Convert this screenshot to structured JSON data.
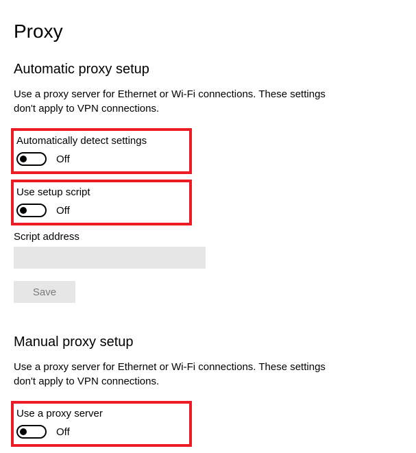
{
  "page": {
    "title": "Proxy"
  },
  "automatic": {
    "heading": "Automatic proxy setup",
    "description": "Use a proxy server for Ethernet or Wi-Fi connections. These settings don't apply to VPN connections.",
    "autodetect": {
      "label": "Automatically detect settings",
      "state": "Off"
    },
    "setup_script": {
      "label": "Use setup script",
      "state": "Off"
    },
    "script_address": {
      "label": "Script address",
      "value": ""
    },
    "save_label": "Save"
  },
  "manual": {
    "heading": "Manual proxy setup",
    "description": "Use a proxy server for Ethernet or Wi-Fi connections. These settings don't apply to VPN connections.",
    "use_proxy": {
      "label": "Use a proxy server",
      "state": "Off"
    }
  }
}
